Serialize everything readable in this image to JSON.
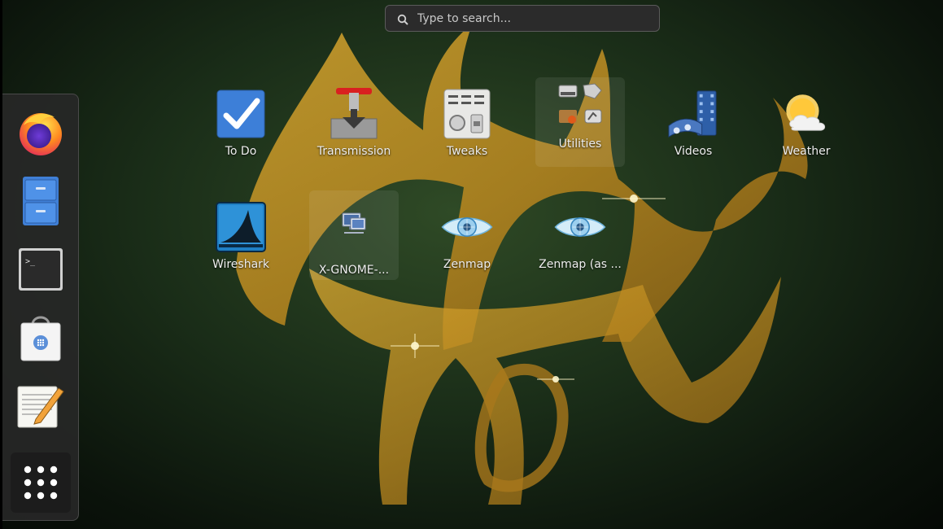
{
  "search": {
    "placeholder": "Type to search..."
  },
  "dash": {
    "items": [
      {
        "name": "Firefox",
        "icon": "firefox-icon"
      },
      {
        "name": "Files",
        "icon": "file-cabinet-icon"
      },
      {
        "name": "Terminal",
        "icon": "terminal-icon"
      },
      {
        "name": "Software",
        "icon": "software-bag-icon"
      },
      {
        "name": "Text Editor",
        "icon": "text-editor-icon"
      },
      {
        "name": "Show Applications",
        "icon": "app-grid-icon"
      }
    ]
  },
  "apps": [
    {
      "label": "To Do",
      "icon": "checkbox-icon"
    },
    {
      "label": "Transmission",
      "icon": "transmission-icon"
    },
    {
      "label": "Tweaks",
      "icon": "tweaks-icon"
    },
    {
      "label": "Utilities",
      "icon": "folder-grid-icon"
    },
    {
      "label": "Videos",
      "icon": "film-icon"
    },
    {
      "label": "Weather",
      "icon": "weather-icon"
    },
    {
      "label": "Wireshark",
      "icon": "wireshark-fin-icon"
    },
    {
      "label": "X-GNOME-...",
      "icon": "remote-desktop-icon"
    },
    {
      "label": "Zenmap",
      "icon": "zenmap-eye-icon"
    },
    {
      "label": "Zenmap (as ...",
      "icon": "zenmap-eye-icon"
    }
  ],
  "colors": {
    "wallpaper_symbol": "#c99a28",
    "background": "#1a2d18"
  }
}
